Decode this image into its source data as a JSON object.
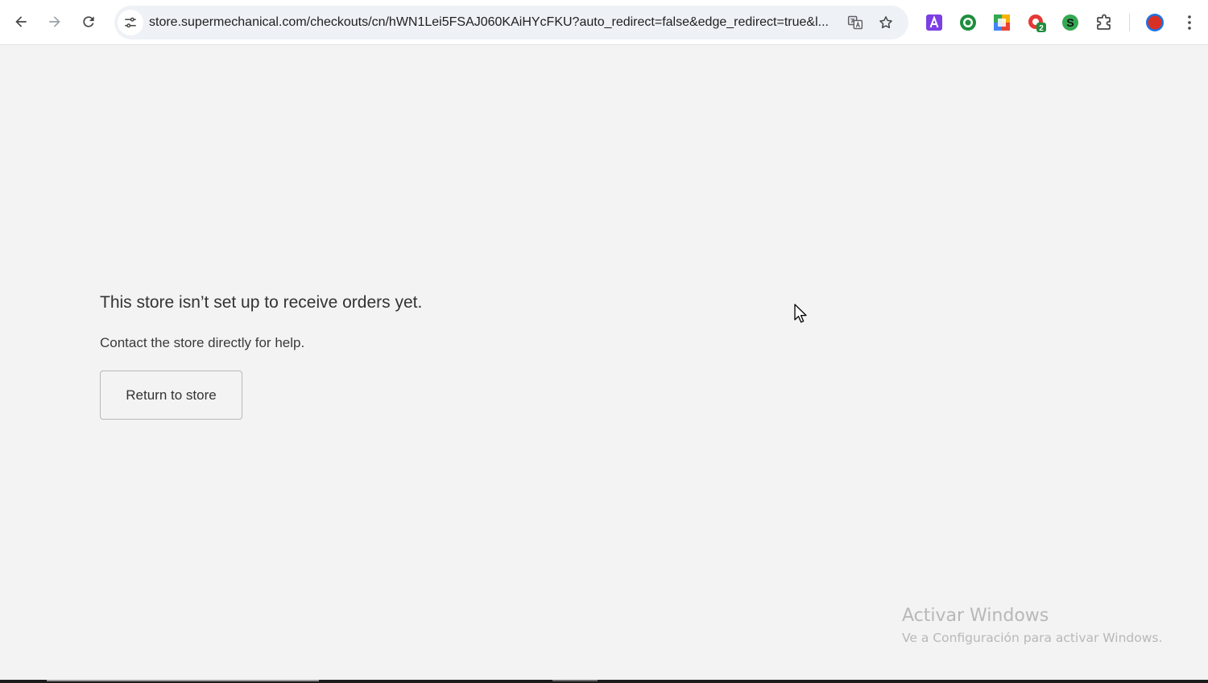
{
  "browser": {
    "url": "store.supermechanical.com/checkouts/cn/hWN1Lei5FSAJ060KAiHYcFKU?auto_redirect=false&edge_redirect=true&l...",
    "nav_icons": [
      "back-arrow-icon",
      "forward-arrow-icon",
      "reload-icon",
      "site-info-icon"
    ],
    "omnibox_icons": [
      "translate-icon",
      "bookmark-star-icon"
    ],
    "extensions": [
      {
        "name": "text-a-extension-icon",
        "color": "#7b3fe4"
      },
      {
        "name": "green-circle-extension-icon",
        "color": "#1e8e3e"
      },
      {
        "name": "grid-extension-icon",
        "color": "#f4b400"
      },
      {
        "name": "red-badge-extension-icon",
        "color": "#e53935",
        "badge": "2"
      },
      {
        "name": "s-extension-icon",
        "color": "#34a853",
        "letter": "S"
      },
      {
        "name": "puzzle-extensions-icon",
        "color": "#444746"
      }
    ],
    "profile_color": "#d93025"
  },
  "page": {
    "heading": "This store isn’t set up to receive orders yet.",
    "subtext": "Contact the store directly for help.",
    "return_button": "Return to store"
  },
  "watermark": {
    "title": "Activar Windows",
    "subtitle": "Ve a Configuración para activar Windows."
  }
}
